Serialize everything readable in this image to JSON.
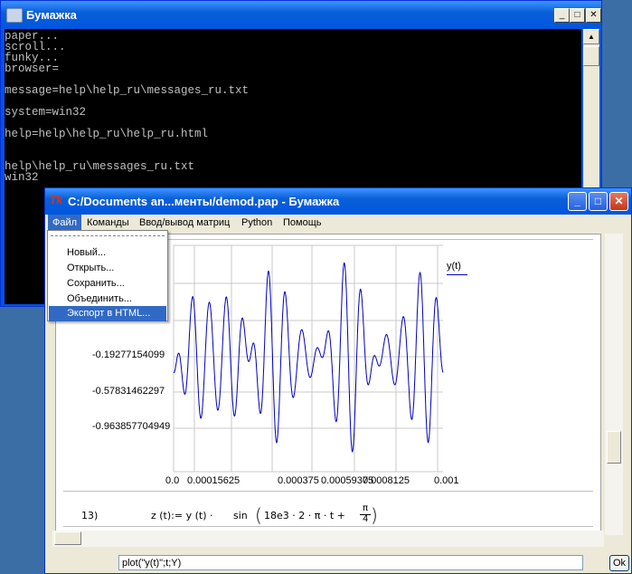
{
  "console": {
    "title": "Бумажка",
    "lines": "paper...\nscroll...\nfunky...\nbrowser=\n\nmessage=help\\help_ru\\messages_ru.txt\n\nsystem=win32\n\nhelp=help\\help_ru\\help_ru.html\n\n\nhelp\\help_ru\\messages_ru.txt\nwin32",
    "minimize": "_",
    "maximize": "□",
    "close": "✕"
  },
  "paper": {
    "title_icon": "Tk",
    "title": "C:/Documents an...менты/demod.pap - Бумажка",
    "menu": [
      "Файл",
      "Команды",
      "Ввод/вывод матриц",
      "Python",
      "Помощь"
    ],
    "file_menu": [
      "Новый...",
      "Открыть...",
      "Сохранить...",
      "Объединить...",
      "Экспорт в HTML..."
    ],
    "command_input": "plot(\"y(t)\";t;Y)",
    "ok_label": "Ok"
  },
  "chart_data": {
    "type": "line",
    "series": [
      {
        "name": "y(t)",
        "color": "#0000c0"
      }
    ],
    "y_tick_labels": [
      "-0.19277154099",
      "-0.57831462297",
      "-0.963857704949"
    ],
    "x_tick_labels": [
      "0.0",
      "0.00015625",
      "0.000375",
      "0.00059375",
      "0.0008125",
      "0.001"
    ],
    "xlim": [
      0,
      0.001
    ],
    "ylim": [
      -0.963857704949,
      0.963857704949
    ],
    "grid": true,
    "legend": "top-right"
  },
  "formula": {
    "number": "13)",
    "lhs": "z (t):= y (t) ·",
    "rhs": "sin",
    "args": "18e3  ·  2  ·  π  ·  t  +",
    "frac_num": "π",
    "frac_den": "4"
  }
}
